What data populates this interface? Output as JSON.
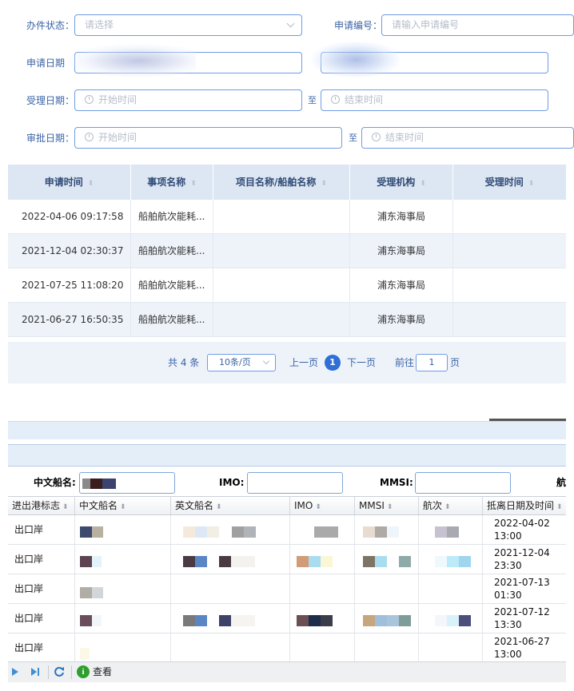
{
  "search_form": {
    "status_label": "办件状态：",
    "status_placeholder": "请选择",
    "apply_no_label": "申请编号：",
    "apply_no_placeholder": "请输入申请编号",
    "apply_date_label": "申请日期",
    "accept_date_label": "受理日期：",
    "approve_date_label": "审批日期：",
    "start_placeholder": "开始时间",
    "end_placeholder": "结束时间",
    "range_sep": "至"
  },
  "top_table": {
    "columns": [
      "申请时间",
      "事项名称",
      "项目名称/船舶名称",
      "受理机构",
      "受理时间"
    ],
    "rows": [
      {
        "time": "2022-04-06 09:17:58",
        "item": "船舶航次能耗...",
        "project": "",
        "org": "浦东海事局",
        "accept": ""
      },
      {
        "time": "2021-12-04 02:30:37",
        "item": "船舶航次能耗...",
        "project": "",
        "org": "浦东海事局",
        "accept": ""
      },
      {
        "time": "2021-07-25 11:08:20",
        "item": "船舶航次能耗...",
        "project": "",
        "org": "浦东海事局",
        "accept": ""
      },
      {
        "time": "2021-06-27 16:50:35",
        "item": "船舶航次能耗...",
        "project": "",
        "org": "浦东海事局",
        "accept": ""
      }
    ]
  },
  "pagination": {
    "total": "共 4 条",
    "page_size": "10条/页",
    "prev": "上一页",
    "current": "1",
    "next": "下一页",
    "goto_label": "前往",
    "goto_value": "1",
    "page_unit": "页"
  },
  "bottom_filters": {
    "cn_name_label": "中文船名:",
    "imo_label": "IMO:",
    "mmsi_label": "MMSI:",
    "voyage_label_partial": "航"
  },
  "bottom_grid": {
    "columns": [
      "进出港标志",
      "中文船名",
      "英文船名",
      "IMO",
      "MMSI",
      "航次",
      "抵离日期及时间"
    ],
    "rows": [
      {
        "flag": "出口岸",
        "date": "2022-04-02",
        "time": "13:00"
      },
      {
        "flag": "出口岸",
        "date": "2021-12-04",
        "time": "23:30"
      },
      {
        "flag": "出口岸",
        "date": "2021-07-13",
        "time": "01:30"
      },
      {
        "flag": "出口岸",
        "date": "2021-07-12",
        "time": "13:30"
      },
      {
        "flag": "出口岸",
        "date": "2021-06-27",
        "time": "13:00"
      }
    ]
  },
  "toolbar": {
    "view_label": "查看"
  },
  "colors": {
    "accent": "#2f6fd6",
    "header_bg": "#dde6f3",
    "row_alt": "#eef3fa",
    "label_blue": "#3a63a6"
  },
  "icons": [
    "chevron-down-icon",
    "clock-icon",
    "sort-icon",
    "next-page-icon",
    "last-page-icon",
    "refresh-icon",
    "info-icon"
  ]
}
